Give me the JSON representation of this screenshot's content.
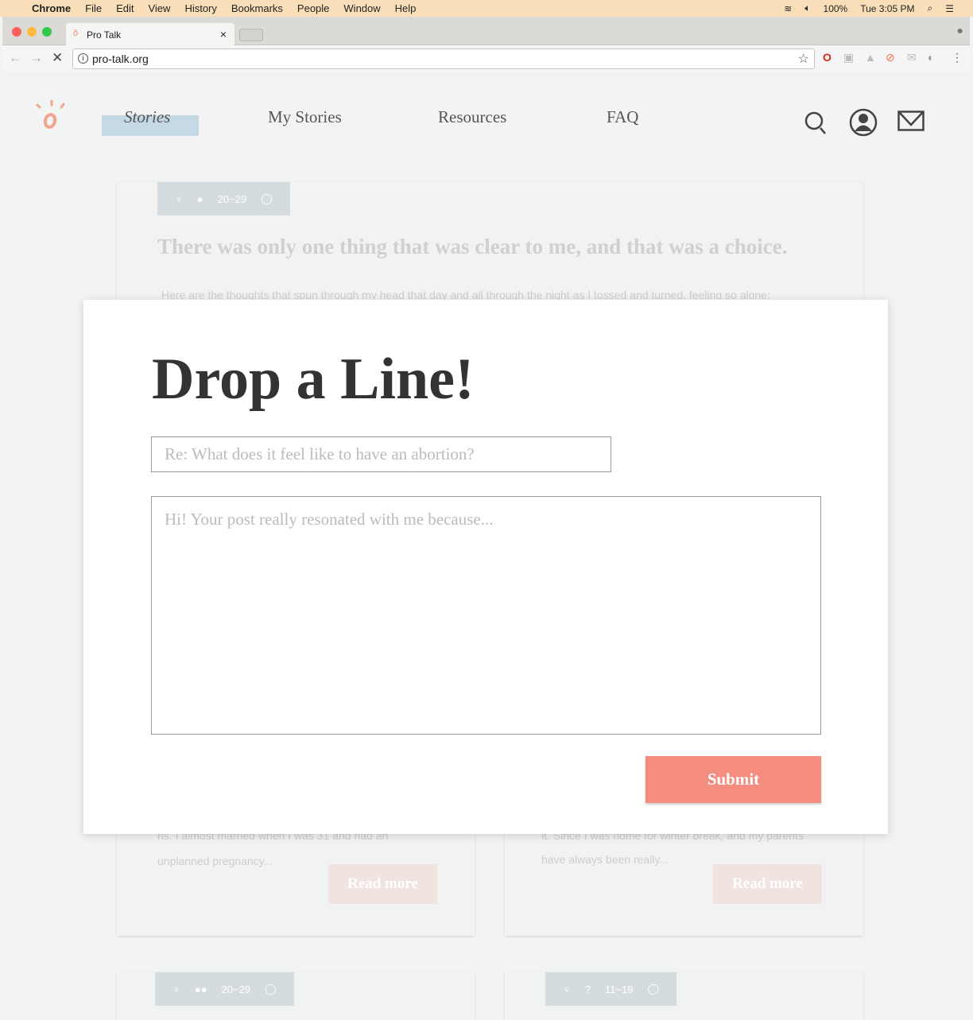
{
  "menubar": {
    "app": "Chrome",
    "items": [
      "File",
      "Edit",
      "View",
      "History",
      "Bookmarks",
      "People",
      "Window",
      "Help"
    ],
    "battery": "100%",
    "clock": "Tue 3:05 PM"
  },
  "browser": {
    "tab_title": "Pro Talk",
    "url": "pro-talk.org"
  },
  "nav": {
    "items": [
      "Stories",
      "My Stories",
      "Resources",
      "FAQ"
    ],
    "active": "Stories"
  },
  "cards": [
    {
      "age": "20~29",
      "title": "There was only one thing that was clear to me, and that was a choice.",
      "excerpt": "Here are the thoughts that spun through my head that day and all through the night as I tossed and turned, feeling so alone:"
    },
    {
      "excerpt_1": "ns. I almost married when I was 31 and had an",
      "excerpt_2": "unplanned pregnancy...",
      "button": "Read more"
    },
    {
      "excerpt_1": "it. Since I was home for winter break, and my parents",
      "excerpt_2": "have always been really...",
      "button": "Read more"
    },
    {
      "age": "20~29"
    },
    {
      "age": "11~19"
    }
  ],
  "modal": {
    "title": "Drop a Line!",
    "subject_value": "Re: What does it feel like to have an abortion?",
    "message_placeholder": "Hi! Your post really resonated with me because...",
    "submit": "Submit"
  },
  "colors": {
    "accent": "#f48d7f",
    "nav_highlight": "#c5d9e5",
    "tag": "#d5dce0"
  }
}
